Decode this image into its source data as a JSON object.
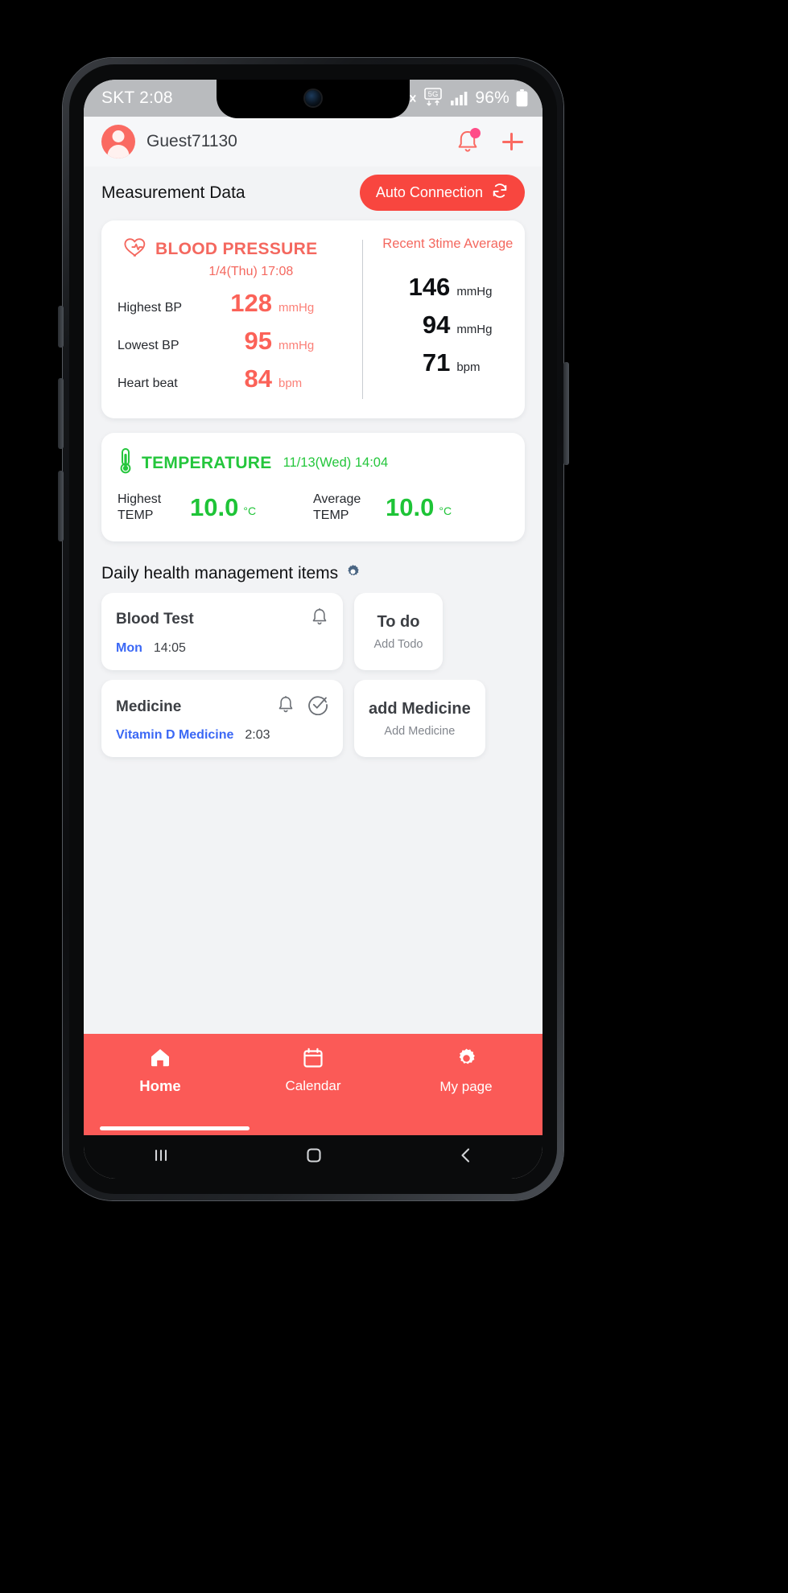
{
  "status_bar": {
    "carrier_time": "SKT 2:08",
    "network": "5G",
    "battery_pct": "96%",
    "icons": [
      "mute-icon",
      "5g-icon",
      "signal-bars-icon",
      "battery-icon"
    ]
  },
  "header": {
    "username": "Guest71130",
    "bell_icon": "notification-bell-icon",
    "add_icon": "plus-icon"
  },
  "measurement": {
    "section_title": "Measurement Data",
    "auto_connection_label": "Auto Connection",
    "auto_connection_icon": "refresh-icon",
    "accent_color": "#f8463f"
  },
  "blood_pressure": {
    "title": "BLOOD PRESSURE",
    "icon": "heart-pulse-icon",
    "date": "1/4(Thu) 17:08",
    "color": "#f4685f",
    "rows": [
      {
        "label": "Highest BP",
        "value": "128",
        "unit": "mmHg"
      },
      {
        "label": "Lowest BP",
        "value": "95",
        "unit": "mmHg"
      },
      {
        "label": "Heart beat",
        "value": "84",
        "unit": "bpm"
      }
    ],
    "average_title": "Recent 3time Average",
    "average_rows": [
      {
        "value": "146",
        "unit": "mmHg"
      },
      {
        "value": "94",
        "unit": "mmHg"
      },
      {
        "value": "71",
        "unit": "bpm"
      }
    ]
  },
  "temperature": {
    "title": "TEMPERATURE",
    "icon": "thermometer-icon",
    "date": "11/13(Wed) 14:04",
    "color": "#24c63c",
    "cells": [
      {
        "label": "Highest\nTEMP",
        "label_line1": "Highest",
        "label_line2": "TEMP",
        "value": "10.0",
        "unit": "°C"
      },
      {
        "label": "Average\nTEMP",
        "label_line1": "Average",
        "label_line2": "TEMP",
        "value": "10.0",
        "unit": "°C"
      }
    ]
  },
  "daily": {
    "section_title": "Daily health management items",
    "settings_icon": "gear-icon",
    "cards": [
      {
        "name": "Blood Test",
        "icons": [
          "bell-icon"
        ],
        "day": "Mon",
        "time": "14:05"
      },
      {
        "name": "Medicine",
        "icons": [
          "bell-icon",
          "check-circle-icon"
        ],
        "day": "Vitamin D Medicine",
        "time": "2:03"
      }
    ],
    "add_cards": [
      {
        "title": "To do",
        "subtitle": "Add Todo"
      },
      {
        "title": "add Medicine",
        "subtitle": "Add Medicine"
      }
    ]
  },
  "bottom_nav": {
    "background": "#fb5a57",
    "items": [
      {
        "label": "Home",
        "icon": "home-icon",
        "active": true
      },
      {
        "label": "Calendar",
        "icon": "calendar-icon",
        "active": false
      },
      {
        "label": "My page",
        "icon": "gear-icon",
        "active": false
      }
    ]
  },
  "os_nav": {
    "items": [
      "recents-icon",
      "home-square-icon",
      "back-chevron-icon"
    ]
  }
}
